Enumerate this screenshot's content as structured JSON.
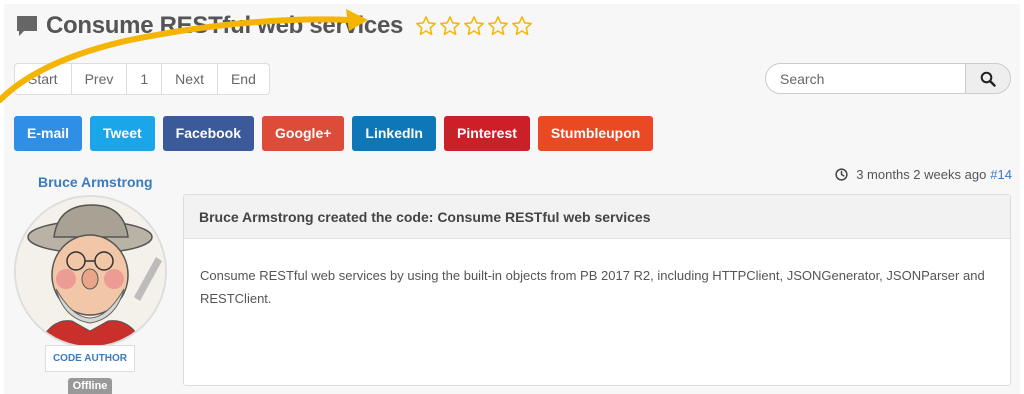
{
  "title": "Consume RESTful web services",
  "rating": {
    "value": 0,
    "max": 5
  },
  "pagination": [
    "Start",
    "Prev",
    "1",
    "Next",
    "End"
  ],
  "search": {
    "placeholder": "Search"
  },
  "share_buttons": [
    {
      "label": "E-mail",
      "color": "#2f8fe6"
    },
    {
      "label": "Tweet",
      "color": "#1ba6e9"
    },
    {
      "label": "Facebook",
      "color": "#3b5a9a"
    },
    {
      "label": "Google+",
      "color": "#dd4b39"
    },
    {
      "label": "LinkedIn",
      "color": "#0d77b7"
    },
    {
      "label": "Pinterest",
      "color": "#cb2027"
    },
    {
      "label": "Stumbleupon",
      "color": "#eb4924"
    }
  ],
  "post": {
    "author": "Bruce Armstrong",
    "role": "CODE AUTHOR",
    "status": "Offline",
    "time": "3 months 2 weeks ago",
    "permalink": "#14",
    "header": "Bruce Armstrong created the code: Consume RESTful web services",
    "body": "Consume RESTful web services by using the built-in objects from PB 2017 R2, including HTTPClient, JSONGenerator, JSONParser and RESTClient."
  },
  "colors": {
    "accent": "#3a7bbf",
    "star": "#f5b400",
    "arrow": "#f5b400"
  }
}
